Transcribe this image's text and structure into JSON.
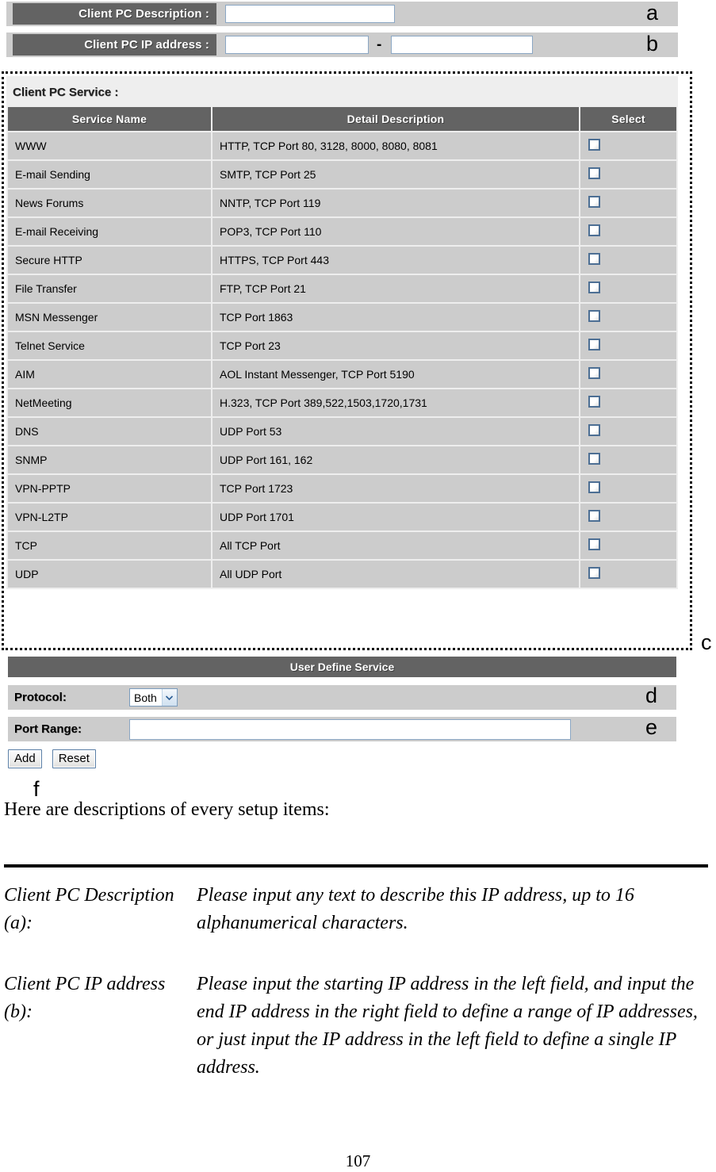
{
  "ui": {
    "top_form": {
      "rows": [
        {
          "label": "Client PC Description :",
          "value": "",
          "marker": "a"
        },
        {
          "label": "Client PC IP address :",
          "value_start": "",
          "value_end": "",
          "separator": "-",
          "marker": "b"
        }
      ]
    },
    "service_section": {
      "caption": "Client PC Service :",
      "marker": "c",
      "columns": [
        "Service Name",
        "Detail Description",
        "Select"
      ],
      "rows": [
        {
          "name": "WWW",
          "detail": "HTTP, TCP Port 80, 3128, 8000, 8080, 8081",
          "checked": false
        },
        {
          "name": "E-mail Sending",
          "detail": "SMTP, TCP Port 25",
          "checked": false
        },
        {
          "name": "News Forums",
          "detail": "NNTP, TCP Port 119",
          "checked": false
        },
        {
          "name": "E-mail Receiving",
          "detail": "POP3, TCP Port 110",
          "checked": false
        },
        {
          "name": "Secure HTTP",
          "detail": "HTTPS, TCP Port 443",
          "checked": false
        },
        {
          "name": "File Transfer",
          "detail": "FTP, TCP Port 21",
          "checked": false
        },
        {
          "name": "MSN Messenger",
          "detail": "TCP Port 1863",
          "checked": false
        },
        {
          "name": "Telnet Service",
          "detail": "TCP Port 23",
          "checked": false
        },
        {
          "name": "AIM",
          "detail": "AOL Instant Messenger, TCP Port 5190",
          "checked": false
        },
        {
          "name": "NetMeeting",
          "detail": "H.323, TCP Port 389,522,1503,1720,1731",
          "checked": false
        },
        {
          "name": "DNS",
          "detail": "UDP Port 53",
          "checked": false
        },
        {
          "name": "SNMP",
          "detail": "UDP Port 161, 162",
          "checked": false
        },
        {
          "name": "VPN-PPTP",
          "detail": "TCP Port 1723",
          "checked": false
        },
        {
          "name": "VPN-L2TP",
          "detail": "UDP Port 1701",
          "checked": false
        },
        {
          "name": "TCP",
          "detail": "All TCP Port",
          "checked": false
        },
        {
          "name": "UDP",
          "detail": "All UDP Port",
          "checked": false
        }
      ]
    },
    "user_define_service": {
      "title": "User Define Service",
      "protocol": {
        "label": "Protocol:",
        "selected": "Both",
        "marker": "d"
      },
      "port_range": {
        "label": "Port Range:",
        "value": "",
        "marker": "e"
      },
      "buttons": {
        "add": "Add",
        "reset": "Reset",
        "marker": "f"
      }
    },
    "colors": {
      "header_gray": "#636363",
      "row_gray": "#cccccc",
      "panel_gray": "#eeeeee",
      "checkbox_border": "#4d6f94",
      "input_border": "#8ba7c4"
    }
  },
  "document": {
    "intro": "Here are descriptions of every setup items:",
    "descriptions": [
      {
        "term": "Client PC Description (a):",
        "definition": "Please input any text to describe this IP address, up to 16 alphanumerical characters."
      },
      {
        "term": "Client PC IP address (b):",
        "definition": "Please input the starting IP address in the left field, and input the end IP address in the right field to define a range of IP addresses, or just input the IP address in the left field to define a single IP address."
      }
    ],
    "page_number": "107"
  }
}
